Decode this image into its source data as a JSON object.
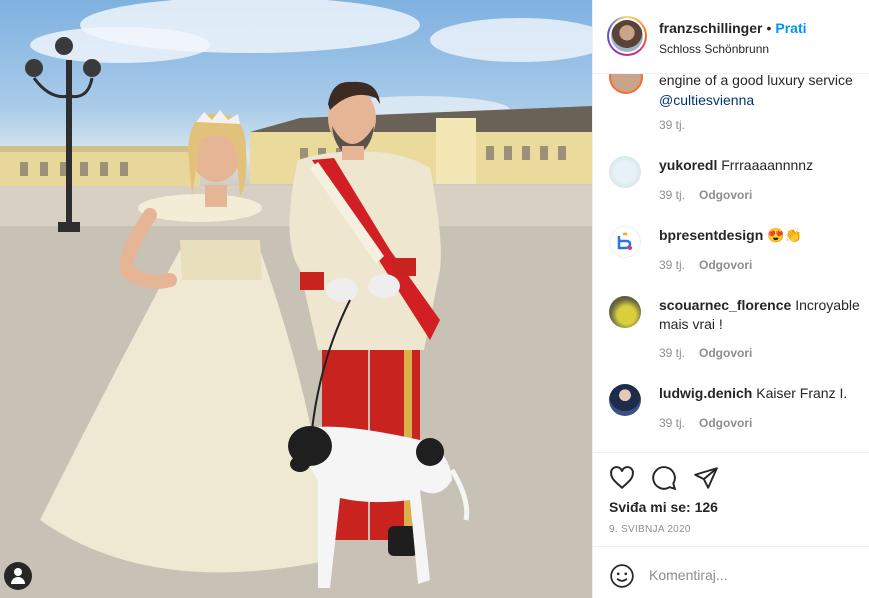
{
  "post": {
    "username": "franzschillinger",
    "separator": "•",
    "follow_label": "Prati",
    "location": "Schloss Schönbrunn"
  },
  "caption_tail": {
    "text": "engine of a good luxury service",
    "mention": "@cultiesvienna",
    "time": "39 tj."
  },
  "comments": [
    {
      "user": "yukoredl",
      "text": "Frrraaaannnnz",
      "time": "39 tj.",
      "reply": "Odgovori"
    },
    {
      "user": "bpresentdesign",
      "text": "😍👏",
      "time": "39 tj.",
      "reply": "Odgovori"
    },
    {
      "user": "scouarnec_florence",
      "text": "Incroyable mais vrai !",
      "time": "39 tj.",
      "reply": "Odgovori"
    },
    {
      "user": "ludwig.denich",
      "text": "Kaiser Franz I.",
      "time": "39 tj.",
      "reply": "Odgovori"
    }
  ],
  "actions": {
    "likes": "Sviđa mi se: 126",
    "date": "9. SVIBNJA 2020"
  },
  "add_comment": {
    "placeholder": "Komentiraj..."
  },
  "icons": {
    "like": "heart-icon",
    "comment": "speech-bubble-icon",
    "share": "paper-plane-icon",
    "emoji": "smiley-icon",
    "tag": "person-tag-icon"
  },
  "colors": {
    "link": "#0095f6",
    "mention": "#00376b",
    "muted": "#8e8e8e",
    "text": "#262626"
  }
}
